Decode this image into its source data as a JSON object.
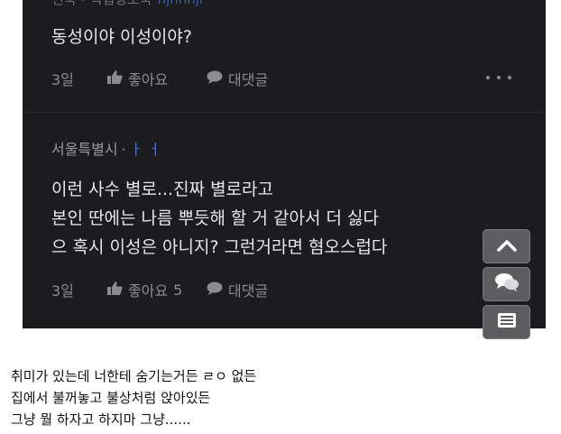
{
  "comment1": {
    "author_partial": "전국 - 직업정보국",
    "handle_partial": "hjnhnji",
    "body": "동성이야 이성이야?",
    "time": "3일",
    "like_label": "좋아요",
    "reply_label": "대댓글"
  },
  "comment2": {
    "author": "서울특별시",
    "separator": "·",
    "handle": "ㅏ ㅓ",
    "lines": [
      "이런 사수 별로...진짜 별로라고",
      "본인 딴에는 나름 뿌듯해 할 거 같아서 더 싫다",
      "으 혹시 이성은 아니지? 그런거라면 혐오스럽다"
    ],
    "time": "3일",
    "like_label": "좋아요",
    "like_count": "5",
    "reply_label": "대댓글"
  },
  "floating_buttons": [
    "chevron-up-icon",
    "comments-icon",
    "list-icon"
  ],
  "caption": {
    "lines": [
      "취미가 있는데 너한테 숨기는거든 ㄹㅇ 없든",
      "집에서 불꺼놓고 불상처럼 앉아있든",
      "그냥 뭘 하자고 하지마 그냥......"
    ]
  },
  "colors": {
    "panel_bg": "#1c1c1e",
    "text_primary": "#e6e6e8",
    "text_muted": "#8c8c90",
    "handle_blue": "#4a72d1",
    "button_bg": "#5d5d60"
  }
}
